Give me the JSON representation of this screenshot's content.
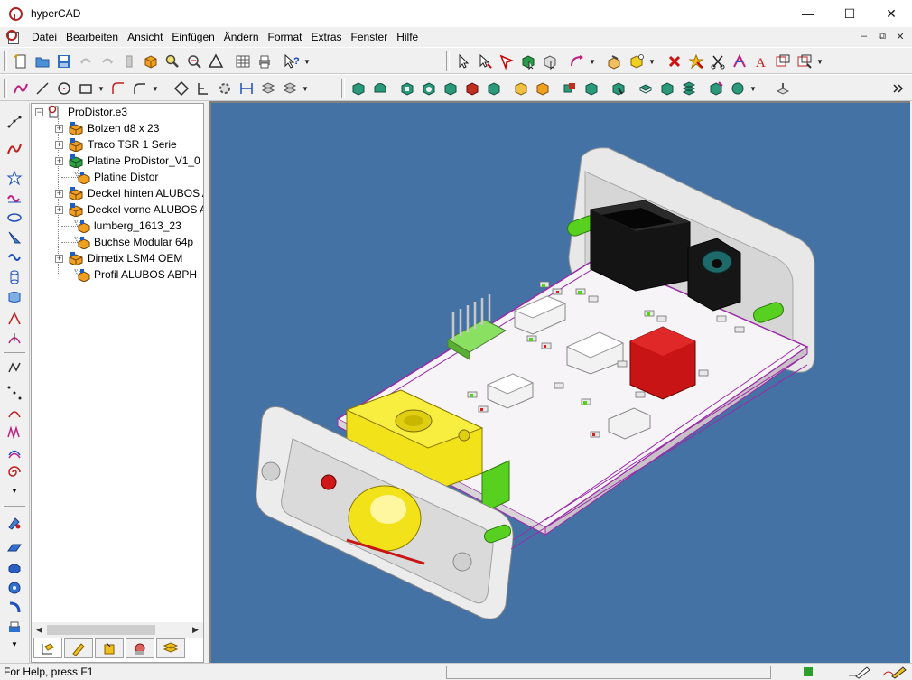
{
  "window": {
    "title": "hyperCAD",
    "minimize": "—",
    "maximize": "☐",
    "close": "✕"
  },
  "menu": {
    "items": [
      "Datei",
      "Bearbeiten",
      "Ansicht",
      "Einfügen",
      "Ändern",
      "Format",
      "Extras",
      "Fenster",
      "Hilfe"
    ],
    "mdi": [
      "–",
      "⧉",
      "✕"
    ]
  },
  "tree": {
    "root": "ProDistor.e3",
    "items": [
      {
        "label": "Bolzen d8 x 23",
        "expandable": true
      },
      {
        "label": "Traco TSR 1 Serie",
        "expandable": true
      },
      {
        "label": "Platine ProDistor_V1_0",
        "expandable": true
      },
      {
        "label": "Platine Distor",
        "expandable": false
      },
      {
        "label": "Deckel hinten ALUBOS A",
        "expandable": true
      },
      {
        "label": "Deckel vorne ALUBOS A",
        "expandable": true
      },
      {
        "label": "lumberg_1613_23",
        "expandable": false
      },
      {
        "label": "Buchse Modular 64p",
        "expandable": false
      },
      {
        "label": "Dimetix LSM4 OEM",
        "expandable": true
      },
      {
        "label": "Profil ALUBOS ABPH",
        "expandable": false
      }
    ],
    "scroll_left": "◀",
    "scroll_right": "▶"
  },
  "status": {
    "help_text": "For Help, press F1"
  },
  "colors": {
    "viewport_bg": "#4472a4",
    "pcb": "#f6f4f6",
    "pcb_trace": "#9a2aa8",
    "yellow_part": "#f2e21a",
    "red_part": "#d01818",
    "green_part": "#58d020",
    "black_part": "#141414"
  },
  "icons": {
    "app": "hypercad-logo-icon",
    "toolbar1": [
      "new-icon",
      "open-icon",
      "save-icon",
      "undo-icon",
      "redo-icon",
      "delete-icon",
      "box-icon",
      "search-icon",
      "measure-icon",
      "triangle-icon",
      "table-icon",
      "print-icon",
      "help-icon",
      "cursor-icon",
      "select-icon",
      "flag-icon",
      "cube-select-icon",
      "cube-select2-icon",
      "curve-arrow-icon",
      "boxes-icon",
      "cube-yellow-icon",
      "cross-red-icon",
      "star-delete-icon",
      "cut-icon",
      "trim-icon",
      "text-icon",
      "layer-icon",
      "layer2-icon"
    ],
    "toolbar2": [
      "spline-icon",
      "line-icon",
      "circle-icon",
      "rect-icon",
      "arc-icon",
      "fillet-icon",
      "diamond-icon",
      "tree-icon",
      "gear-icon",
      "dimension-icon",
      "pattern-icon",
      "pattern2-icon",
      "solid1-icon",
      "solid2-icon",
      "solid3-icon",
      "solid4-icon",
      "solid5-icon",
      "solid6-icon",
      "solid7-icon",
      "solid8-icon",
      "solid9-icon",
      "solid10-icon",
      "solid11-icon",
      "solid12-icon",
      "solid13-icon",
      "solid14-icon",
      "solid15-icon",
      "solid16-icon",
      "solid17-icon",
      "solid18-icon",
      "hand-icon",
      "overflow-icon"
    ]
  }
}
